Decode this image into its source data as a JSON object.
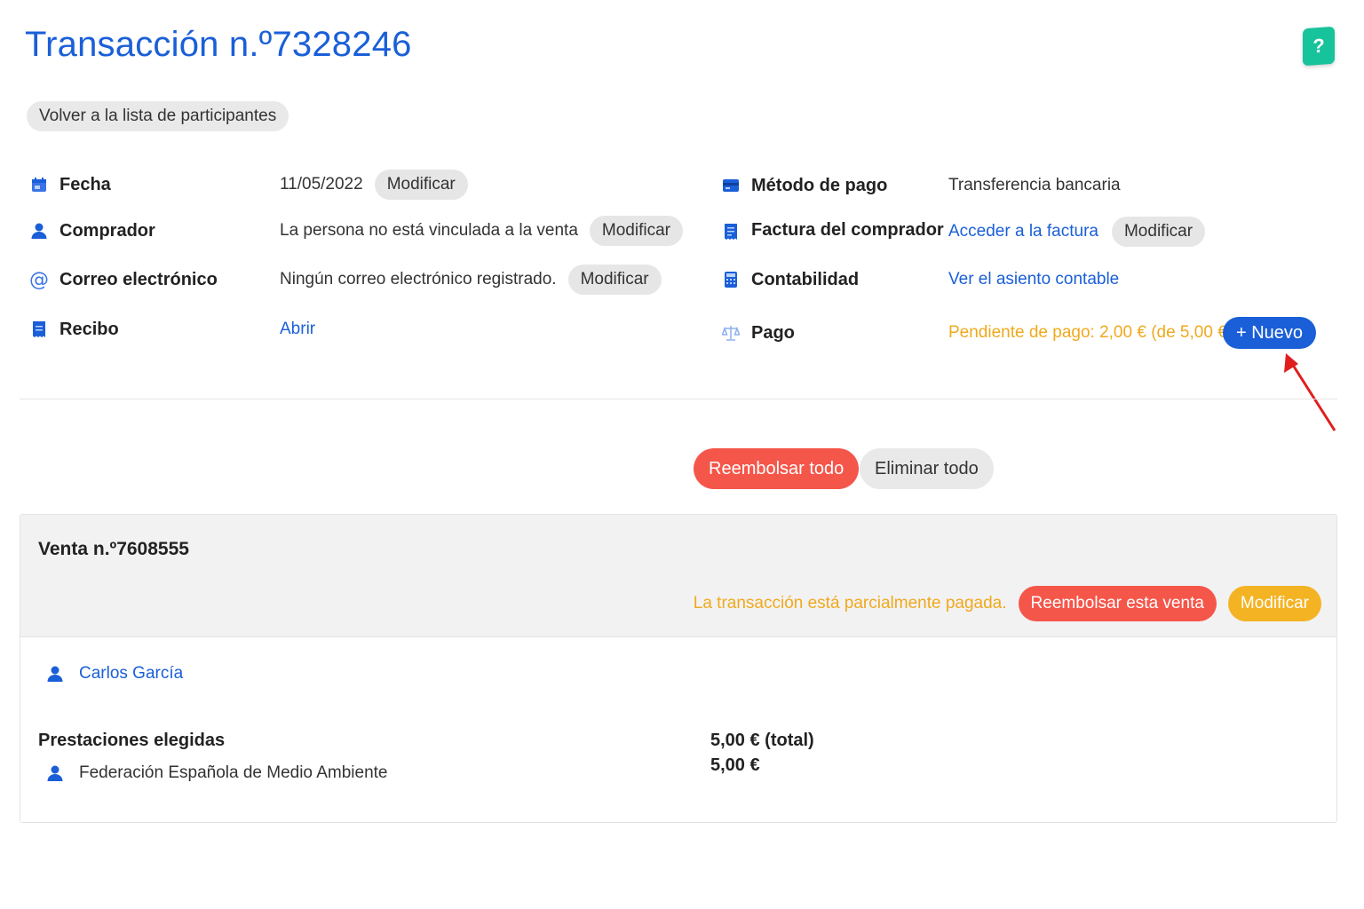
{
  "page": {
    "title": "Transacción n.º7328246",
    "help_label": "?",
    "back_label": "Volver a la lista de participantes"
  },
  "details_left": {
    "date": {
      "label": "Fecha",
      "value": "11/05/2022",
      "action": "Modificar"
    },
    "buyer": {
      "label": "Comprador",
      "value": "La persona no está vinculada a la venta",
      "action": "Modificar"
    },
    "email": {
      "label": "Correo electrónico",
      "value": "Ningún correo electrónico registrado.",
      "action": "Modificar"
    },
    "receipt": {
      "label": "Recibo",
      "link": "Abrir"
    }
  },
  "details_right": {
    "payment_method": {
      "label": "Método de pago",
      "value": "Transferencia bancaria"
    },
    "invoice": {
      "label": "Factura del comprador",
      "link": "Acceder a la factura",
      "action": "Modificar"
    },
    "accounting": {
      "label": "Contabilidad",
      "link": "Ver el asiento contable"
    },
    "payment": {
      "label": "Pago",
      "status": "Pendiente de pago: 2,00 € (de 5,00 €)",
      "new_label": "+ Nuevo"
    }
  },
  "actions": {
    "refund_all": "Reembolsar todo",
    "delete_all": "Eliminar todo"
  },
  "sale": {
    "title": "Venta n.º7608555",
    "status": "La transacción está parcialmente pagada.",
    "refund_label": "Reembolsar esta venta",
    "modify_label": "Modificar",
    "participant": "Carlos García",
    "services_label": "Prestaciones elegidas",
    "service_name": "Federación Española de Medio Ambiente",
    "total": "5,00 € (total)",
    "service_price": "5,00 €"
  },
  "colors": {
    "primary": "#1a5fd8",
    "danger": "#f5564a",
    "warning": "#f0a91d",
    "help": "#17c39a",
    "annotation_arrow": "#e01e1e"
  }
}
